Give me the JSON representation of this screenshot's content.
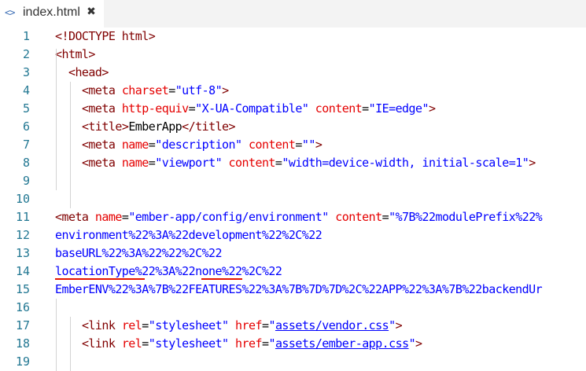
{
  "tab": {
    "icon": "<>",
    "icon_name": "code-file-icon",
    "label": "index.html",
    "close_label": "✖"
  },
  "colors": {
    "tag": "#800000",
    "attribute": "#e50000",
    "string": "#0000ff",
    "line_number": "#237893",
    "error_underline": "#e51400"
  },
  "lines": [
    {
      "num": "1",
      "tokens": [
        {
          "t": "tag",
          "v": "<!DOCTYPE html>"
        }
      ]
    },
    {
      "num": "2",
      "tokens": [
        {
          "t": "tag",
          "v": "<html>"
        }
      ]
    },
    {
      "num": "3",
      "tokens": [
        {
          "t": "text",
          "v": "  "
        },
        {
          "t": "tag",
          "v": "<head>"
        }
      ]
    },
    {
      "num": "4",
      "tokens": [
        {
          "t": "text",
          "v": "    "
        },
        {
          "t": "tag",
          "v": "<meta "
        },
        {
          "t": "attr",
          "v": "charset"
        },
        {
          "t": "text",
          "v": "="
        },
        {
          "t": "str",
          "v": "\"utf-8\""
        },
        {
          "t": "tag",
          "v": ">"
        }
      ]
    },
    {
      "num": "5",
      "tokens": [
        {
          "t": "text",
          "v": "    "
        },
        {
          "t": "tag",
          "v": "<meta "
        },
        {
          "t": "attr",
          "v": "http-equiv"
        },
        {
          "t": "text",
          "v": "="
        },
        {
          "t": "str",
          "v": "\"X-UA-Compatible\""
        },
        {
          "t": "text",
          "v": " "
        },
        {
          "t": "attr",
          "v": "content"
        },
        {
          "t": "text",
          "v": "="
        },
        {
          "t": "str",
          "v": "\"IE=edge\""
        },
        {
          "t": "tag",
          "v": ">"
        }
      ]
    },
    {
      "num": "6",
      "tokens": [
        {
          "t": "text",
          "v": "    "
        },
        {
          "t": "tag",
          "v": "<title>"
        },
        {
          "t": "text",
          "v": "EmberApp"
        },
        {
          "t": "tag",
          "v": "</title>"
        }
      ]
    },
    {
      "num": "7",
      "tokens": [
        {
          "t": "text",
          "v": "    "
        },
        {
          "t": "tag",
          "v": "<meta "
        },
        {
          "t": "attr",
          "v": "name"
        },
        {
          "t": "text",
          "v": "="
        },
        {
          "t": "str",
          "v": "\"description\""
        },
        {
          "t": "text",
          "v": " "
        },
        {
          "t": "attr",
          "v": "content"
        },
        {
          "t": "text",
          "v": "="
        },
        {
          "t": "str",
          "v": "\"\""
        },
        {
          "t": "tag",
          "v": ">"
        }
      ]
    },
    {
      "num": "8",
      "tokens": [
        {
          "t": "text",
          "v": "    "
        },
        {
          "t": "tag",
          "v": "<meta "
        },
        {
          "t": "attr",
          "v": "name"
        },
        {
          "t": "text",
          "v": "="
        },
        {
          "t": "str",
          "v": "\"viewport\""
        },
        {
          "t": "text",
          "v": " "
        },
        {
          "t": "attr",
          "v": "content"
        },
        {
          "t": "text",
          "v": "="
        },
        {
          "t": "str",
          "v": "\"width=device-width, initial-scale=1\""
        },
        {
          "t": "tag",
          "v": ">"
        }
      ]
    },
    {
      "num": "9",
      "tokens": []
    },
    {
      "num": "10",
      "tokens": []
    },
    {
      "num": "11",
      "tokens": [
        {
          "t": "tag",
          "v": "<meta "
        },
        {
          "t": "attr",
          "v": "name"
        },
        {
          "t": "text",
          "v": "="
        },
        {
          "t": "str",
          "v": "\"ember-app/config/environment\""
        },
        {
          "t": "text",
          "v": " "
        },
        {
          "t": "attr",
          "v": "content"
        },
        {
          "t": "text",
          "v": "="
        },
        {
          "t": "str",
          "v": "\"%7B%22modulePrefix%22%"
        }
      ]
    },
    {
      "num": "12",
      "tokens": [
        {
          "t": "str",
          "v": "environment%22%3A%22development%22%2C%22"
        }
      ]
    },
    {
      "num": "13",
      "tokens": [
        {
          "t": "str",
          "v": "baseURL%22%3A%22%22%2C%22"
        }
      ]
    },
    {
      "num": "14",
      "tokens": [
        {
          "t": "str",
          "v": "locationType%22%3A%22none%22%2C%22"
        }
      ]
    },
    {
      "num": "15",
      "tokens": [
        {
          "t": "str",
          "v": "EmberENV%22%3A%7B%22FEATURES%22%3A%7B%7D%7D%2C%22APP%22%3A%7B%22backendUr"
        }
      ]
    },
    {
      "num": "16",
      "tokens": []
    },
    {
      "num": "17",
      "tokens": [
        {
          "t": "text",
          "v": "    "
        },
        {
          "t": "tag",
          "v": "<link "
        },
        {
          "t": "attr",
          "v": "rel"
        },
        {
          "t": "text",
          "v": "="
        },
        {
          "t": "str",
          "v": "\"stylesheet\""
        },
        {
          "t": "text",
          "v": " "
        },
        {
          "t": "attr",
          "v": "href"
        },
        {
          "t": "text",
          "v": "="
        },
        {
          "t": "str",
          "v": "\""
        },
        {
          "t": "link",
          "v": "assets/vendor.css"
        },
        {
          "t": "str",
          "v": "\""
        },
        {
          "t": "tag",
          "v": ">"
        }
      ]
    },
    {
      "num": "18",
      "tokens": [
        {
          "t": "text",
          "v": "    "
        },
        {
          "t": "tag",
          "v": "<link "
        },
        {
          "t": "attr",
          "v": "rel"
        },
        {
          "t": "text",
          "v": "="
        },
        {
          "t": "str",
          "v": "\"stylesheet\""
        },
        {
          "t": "text",
          "v": " "
        },
        {
          "t": "attr",
          "v": "href"
        },
        {
          "t": "text",
          "v": "="
        },
        {
          "t": "str",
          "v": "\""
        },
        {
          "t": "link",
          "v": "assets/ember-app.css"
        },
        {
          "t": "str",
          "v": "\""
        },
        {
          "t": "tag",
          "v": ">"
        }
      ]
    },
    {
      "num": "19",
      "tokens": []
    }
  ]
}
